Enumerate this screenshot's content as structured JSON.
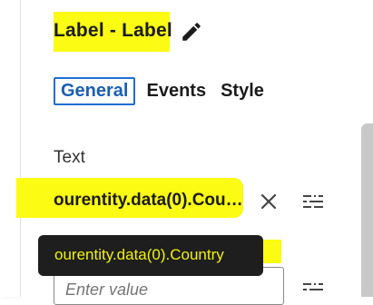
{
  "panel": {
    "title": "Label - Label",
    "edit_icon": "pencil-icon"
  },
  "tabs": [
    {
      "label": "General",
      "active": true
    },
    {
      "label": "Events",
      "active": false
    },
    {
      "label": "Style",
      "active": false
    }
  ],
  "text_field": {
    "label": "Text",
    "value": "ourentity.data(0).Country",
    "clear_icon": "close-icon",
    "options_icon": "tune-icon"
  },
  "tooltip": {
    "text": "ourentity.data(0).Country"
  },
  "next_field": {
    "placeholder": "Enter value",
    "options_icon": "tune-icon"
  },
  "colors": {
    "highlight": "#fbfb14",
    "accent": "#1f6fd1",
    "tooltip_bg": "#1e1e1e",
    "tooltip_text": "#f2f20f"
  }
}
